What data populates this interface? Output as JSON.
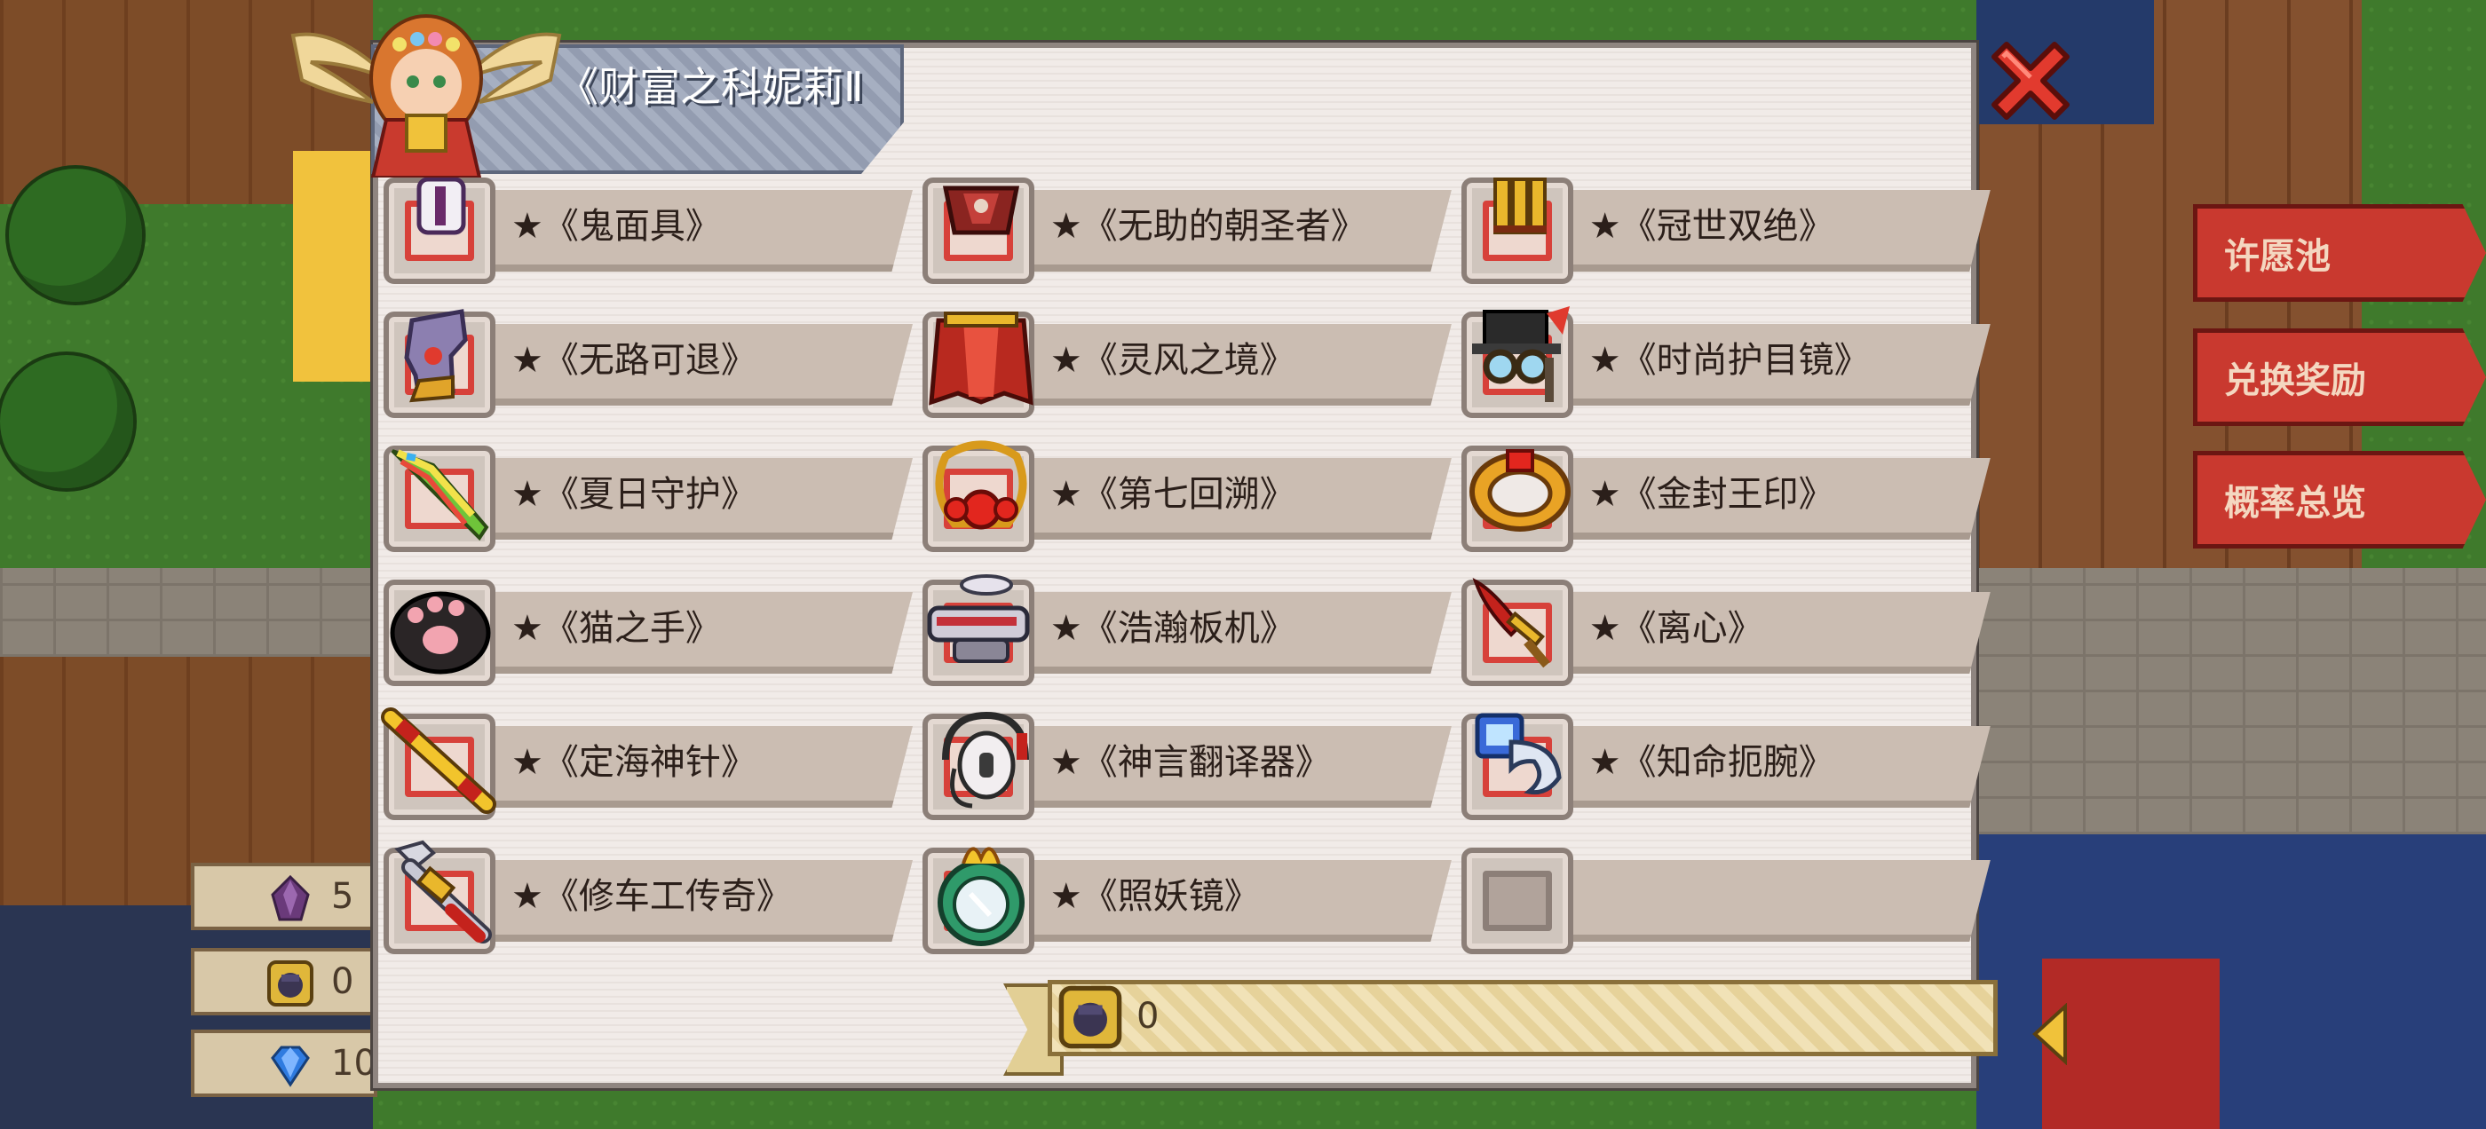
{
  "panel": {
    "title": "《财富之科妮莉Ⅱ"
  },
  "items": [
    [
      {
        "name": "★《鬼面具》",
        "icon": "ghost-mask-icon"
      },
      {
        "name": "★《无助的朝圣者》",
        "icon": "pilgrim-armor-icon"
      },
      {
        "name": "★《冠世双绝》",
        "icon": "twin-crown-icon"
      }
    ],
    [
      {
        "name": "★《无路可退》",
        "icon": "boots-icon"
      },
      {
        "name": "★《灵风之境》",
        "icon": "red-cloak-icon"
      },
      {
        "name": "★《时尚护目镜》",
        "icon": "goggles-hat-icon"
      }
    ],
    [
      {
        "name": "★《夏日守护》",
        "icon": "rainbow-blade-icon"
      },
      {
        "name": "★《第七回溯》",
        "icon": "ruby-necklace-icon"
      },
      {
        "name": "★《金封王印》",
        "icon": "golden-ring-icon"
      }
    ],
    [
      {
        "name": "★《猫之手》",
        "icon": "cat-paw-icon"
      },
      {
        "name": "★《浩瀚板机》",
        "icon": "blaster-icon"
      },
      {
        "name": "★《离心》",
        "icon": "red-dagger-icon"
      }
    ],
    [
      {
        "name": "★《定海神针》",
        "icon": "golden-staff-icon"
      },
      {
        "name": "★《神言翻译器》",
        "icon": "headset-icon"
      },
      {
        "name": "★《知命扼腕》",
        "icon": "robot-claw-icon"
      }
    ],
    [
      {
        "name": "★《修车工传奇》",
        "icon": "wrench-icon"
      },
      {
        "name": "★《照妖镜》",
        "icon": "magic-mirror-icon"
      },
      {
        "name": "",
        "icon": "empty-slot"
      }
    ]
  ],
  "counter": {
    "value": "0",
    "icon": "token-icon"
  },
  "left_currencies": [
    {
      "icon": "crystal-icon",
      "value": "5"
    },
    {
      "icon": "token-icon",
      "value": "0"
    },
    {
      "icon": "gem-icon",
      "value": "10"
    }
  ],
  "side_tabs": [
    "许愿池",
    "兑换奖励",
    "概率总览"
  ],
  "colors": {
    "accent_red": "#d7413a",
    "panel_bg": "#efe9e6",
    "band": "#cbbdb2",
    "title_plate": "#9ba4b7"
  }
}
